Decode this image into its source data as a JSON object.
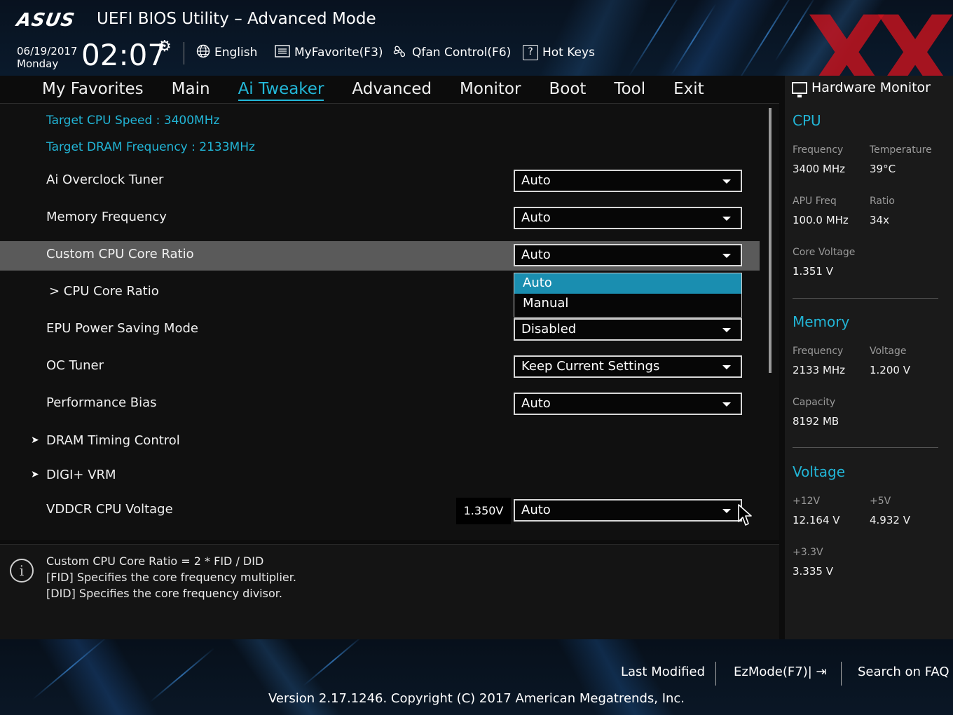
{
  "header": {
    "logo": "ASUS",
    "title": "UEFI BIOS Utility – Advanced Mode",
    "date": "06/19/2017",
    "day": "Monday",
    "time": "02:07",
    "language": "English",
    "myfavorite": "MyFavorite(F3)",
    "qfan": "Qfan Control(F6)",
    "hotkeys": "Hot Keys",
    "watermark": "XX"
  },
  "menu": [
    {
      "label": "My Favorites"
    },
    {
      "label": "Main"
    },
    {
      "label": "Ai Tweaker",
      "active": true
    },
    {
      "label": "Advanced"
    },
    {
      "label": "Monitor"
    },
    {
      "label": "Boot"
    },
    {
      "label": "Tool"
    },
    {
      "label": "Exit"
    }
  ],
  "main": {
    "target_cpu": "Target CPU Speed : 3400MHz",
    "target_dram": "Target DRAM Frequency : 2133MHz",
    "rows": [
      {
        "label": "Ai Overclock Tuner",
        "value": "Auto"
      },
      {
        "label": "Memory Frequency",
        "value": "Auto"
      },
      {
        "label": "Custom CPU Core Ratio",
        "value": "Auto"
      },
      {
        "label": "> CPU Core Ratio"
      },
      {
        "label": "EPU Power Saving Mode",
        "value": "Disabled"
      },
      {
        "label": "OC Tuner",
        "value": "Keep Current Settings"
      },
      {
        "label": "Performance Bias",
        "value": "Auto"
      },
      {
        "label": "DRAM Timing Control"
      },
      {
        "label": "DIGI+ VRM"
      },
      {
        "label": "VDDCR CPU Voltage",
        "value": "Auto",
        "reading": "1.350V"
      }
    ],
    "dropdown_options": [
      "Auto",
      "Manual"
    ]
  },
  "help": {
    "line1": "Custom CPU Core Ratio = 2 * FID / DID",
    "line2": "[FID] Specifies the core frequency multiplier.",
    "line3": "[DID] Specifies the core frequency divisor."
  },
  "hwmon": {
    "title": "Hardware Monitor",
    "cpu": {
      "section": "CPU",
      "frequency_label": "Frequency",
      "frequency": "3400 MHz",
      "temperature_label": "Temperature",
      "temperature": "39°C",
      "apu_label": "APU Freq",
      "apu": "100.0 MHz",
      "ratio_label": "Ratio",
      "ratio": "34x",
      "core_voltage_label": "Core Voltage",
      "core_voltage": "1.351 V"
    },
    "memory": {
      "section": "Memory",
      "frequency_label": "Frequency",
      "frequency": "2133 MHz",
      "voltage_label": "Voltage",
      "voltage": "1.200 V",
      "capacity_label": "Capacity",
      "capacity": "8192 MB"
    },
    "voltage": {
      "section": "Voltage",
      "v12_label": "+12V",
      "v12": "12.164 V",
      "v5_label": "+5V",
      "v5": "4.932 V",
      "v33_label": "+3.3V",
      "v33": "3.335 V"
    }
  },
  "footer": {
    "last_modified": "Last Modified",
    "ezmode": "EzMode(F7)|",
    "search": "Search on FAQ",
    "version": "Version 2.17.1246. Copyright (C) 2017 American Megatrends, Inc."
  },
  "colors": {
    "accent": "#23b7d8",
    "highlight_row": "#5a5a5a",
    "watermark": "#c8141e"
  }
}
